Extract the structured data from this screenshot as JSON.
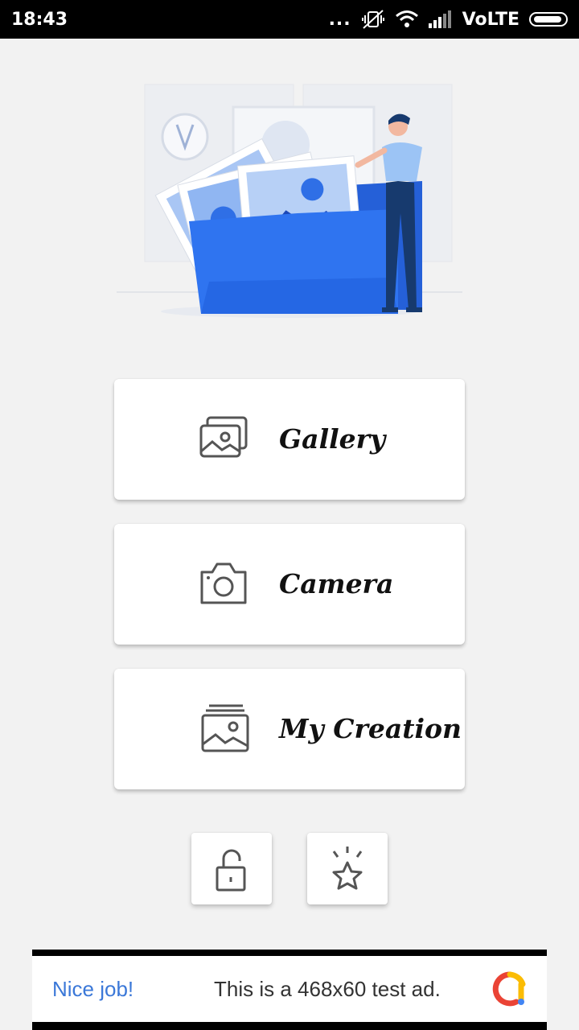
{
  "status_bar": {
    "time": "18:43",
    "dots": "...",
    "network": "VoLTE",
    "icons": [
      "mute-vibrate-icon",
      "wifi-icon",
      "signal-icon",
      "battery-icon"
    ]
  },
  "menu": {
    "gallery_label": "Gallery",
    "camera_label": "Camera",
    "creation_label": "My Creation"
  },
  "small_buttons": {
    "left_icon": "unlock-icon",
    "right_icon": "star-icon"
  },
  "ad": {
    "nice_text": "Nice job!",
    "body_text": "This is a 468x60 test ad."
  },
  "colors": {
    "background": "#f2f2f2",
    "illustration_blue": "#2f6fe6",
    "ad_link": "#3b78d8"
  }
}
